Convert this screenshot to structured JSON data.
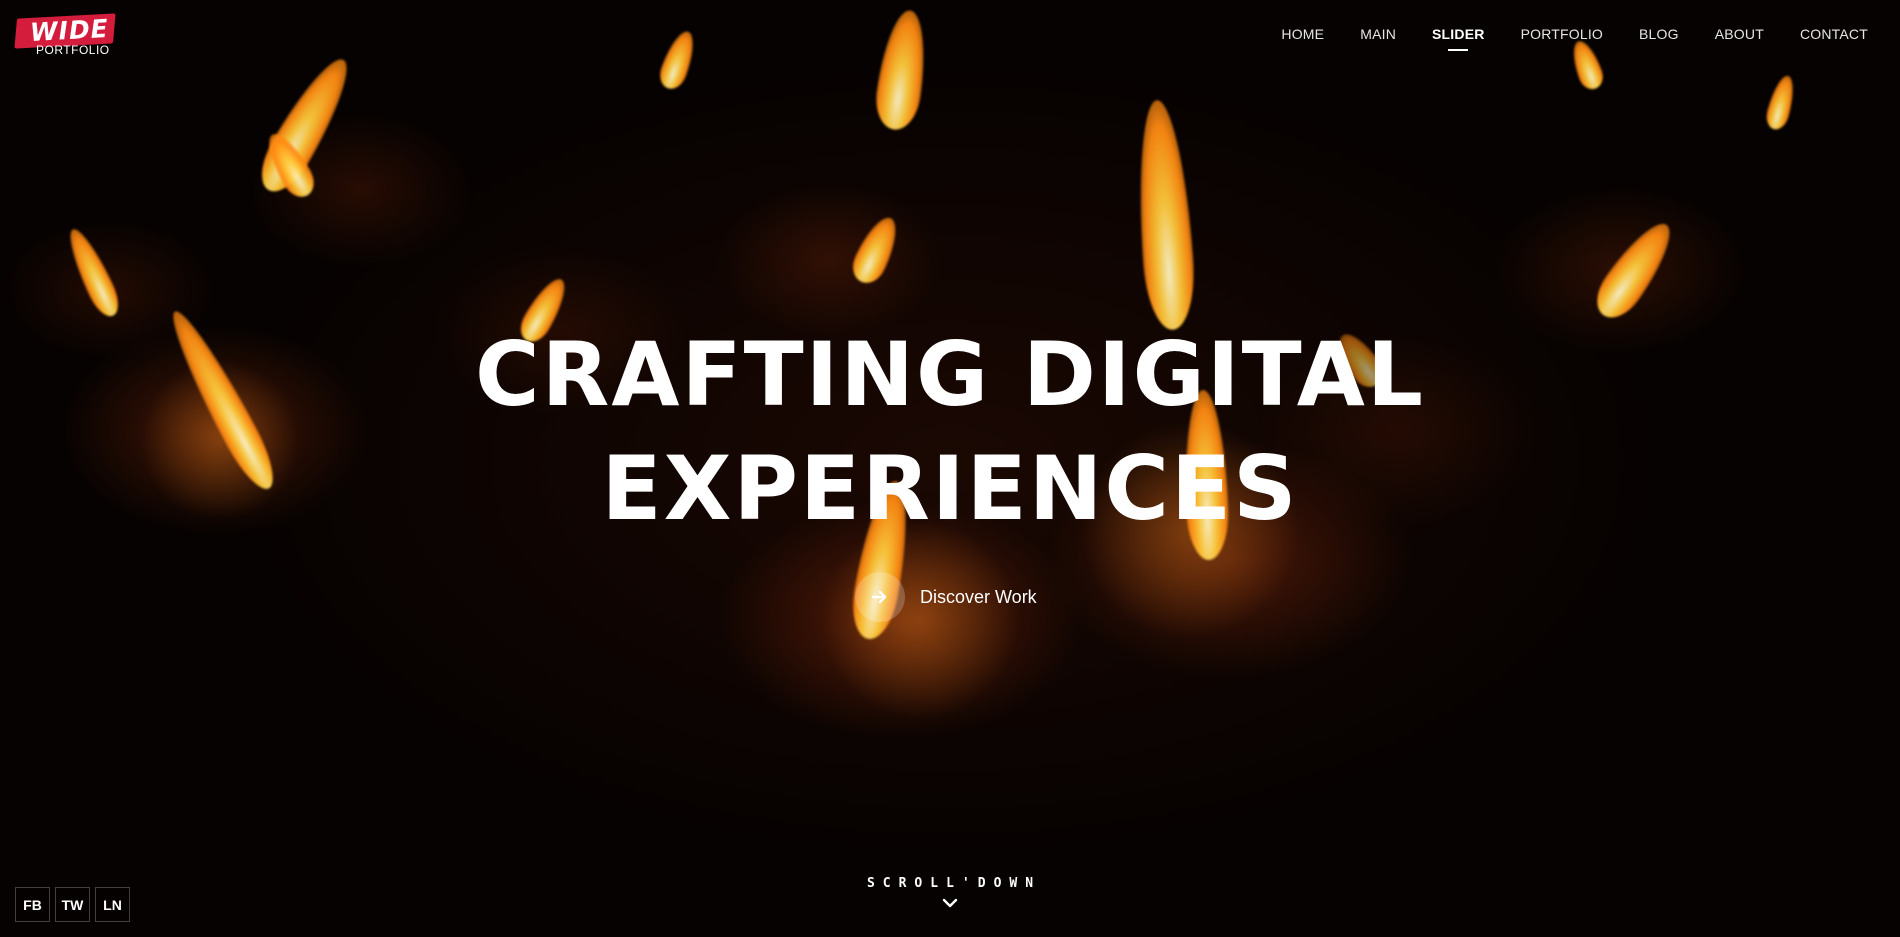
{
  "brand": {
    "logo_word": "WIDE",
    "logo_sub": "PORTFOLIO",
    "accent": "#d41c3c"
  },
  "nav": {
    "items": [
      {
        "label": "HOME"
      },
      {
        "label": "MAIN"
      },
      {
        "label": "SLIDER",
        "active": true
      },
      {
        "label": "PORTFOLIO"
      },
      {
        "label": "BLOG"
      },
      {
        "label": "ABOUT"
      },
      {
        "label": "CONTACT"
      }
    ]
  },
  "hero": {
    "title_line1": "CRAFTING DIGITAL",
    "title_line2": "EXPERIENCES",
    "cta_label": "Discover Work",
    "cta_icon": "arrow-right-icon"
  },
  "scroll": {
    "label": "SCROLL'DOWN",
    "icon": "chevron-down-icon"
  },
  "social": {
    "items": [
      {
        "label": "FB"
      },
      {
        "label": "TW"
      },
      {
        "label": "LN"
      }
    ]
  }
}
